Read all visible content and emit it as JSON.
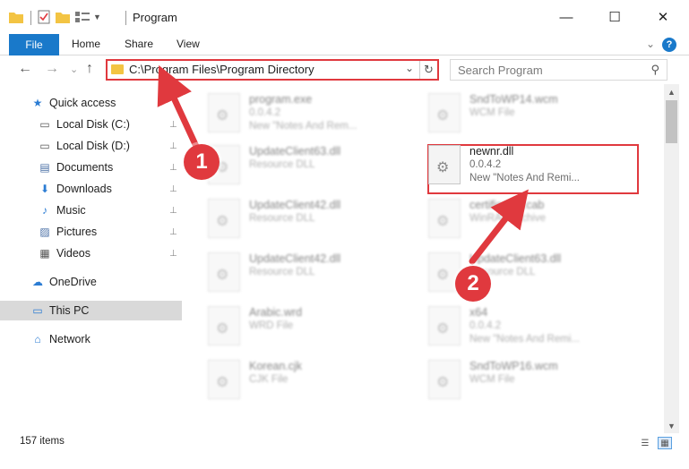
{
  "window": {
    "title": "Program",
    "minimize": "—",
    "maximize": "☐",
    "close": "✕"
  },
  "ribbon": {
    "tabs": [
      "File",
      "Home",
      "Share",
      "View"
    ],
    "expand": "⌄",
    "help": "?"
  },
  "nav": {
    "back": "←",
    "forward": "→",
    "recent": "⌄",
    "up": "↑",
    "address": "C:\\Program Files\\Program Directory",
    "refresh": "↻",
    "search_placeholder": "Search Program",
    "search_icon": "⚲"
  },
  "sidebar": {
    "items": [
      {
        "label": "Quick access",
        "icon": "star-icon",
        "glyph": "★",
        "color": "#2b7cd3",
        "pinned": false
      },
      {
        "label": "Local Disk (C:)",
        "icon": "drive-icon",
        "glyph": "▭",
        "color": "#555555",
        "pinned": true
      },
      {
        "label": "Local Disk (D:)",
        "icon": "drive-icon",
        "glyph": "▭",
        "color": "#555555",
        "pinned": true
      },
      {
        "label": "Documents",
        "icon": "documents-icon",
        "glyph": "▤",
        "color": "#4a6fa5",
        "pinned": true
      },
      {
        "label": "Downloads",
        "icon": "download-icon",
        "glyph": "⬇",
        "color": "#2b7cd3",
        "pinned": true
      },
      {
        "label": "Music",
        "icon": "music-icon",
        "glyph": "♪",
        "color": "#2b7cd3",
        "pinned": true
      },
      {
        "label": "Pictures",
        "icon": "pictures-icon",
        "glyph": "▨",
        "color": "#4a6fa5",
        "pinned": true
      },
      {
        "label": "Videos",
        "icon": "videos-icon",
        "glyph": "▦",
        "color": "#555555",
        "pinned": true
      },
      {
        "label": "OneDrive",
        "icon": "cloud-icon",
        "glyph": "☁",
        "color": "#2b7cd3",
        "pinned": false
      },
      {
        "label": "This PC",
        "icon": "computer-icon",
        "glyph": "▭",
        "color": "#2b7cd3",
        "pinned": false
      },
      {
        "label": "Network",
        "icon": "network-icon",
        "glyph": "⌂",
        "color": "#2b7cd3",
        "pinned": false
      }
    ],
    "pin_glyph": "📌"
  },
  "files": [
    {
      "name": "program.exe",
      "line2": "0.0.4.2",
      "line3": "New \"Notes And Rem...",
      "blurred": true
    },
    {
      "name": "SndToWP14.wcm",
      "line2": "WCM File",
      "line3": "",
      "blurred": true
    },
    {
      "name": "UpdateClient63.dll",
      "line2": "Resource DLL",
      "line3": "",
      "blurred": true
    },
    {
      "name": "newnr.dll",
      "line2": "0.0.4.2",
      "line3": "New \"Notes And Remi...",
      "blurred": false
    },
    {
      "name": "UpdateClient42.dll",
      "line2": "Resource DLL",
      "line3": "",
      "blurred": true
    },
    {
      "name": "certificates.cab",
      "line2": "WinRAR Archive",
      "line3": "",
      "blurred": true
    },
    {
      "name": "UpdateClient42.dll",
      "line2": "Resource DLL",
      "line3": "",
      "blurred": true
    },
    {
      "name": "UpdateClient63.dll",
      "line2": "Resource DLL",
      "line3": "",
      "blurred": true
    },
    {
      "name": "Arabic.wrd",
      "line2": "WRD File",
      "line3": "",
      "blurred": true
    },
    {
      "name": "x64",
      "line2": "0.0.4.2",
      "line3": "New \"Notes And Remi...",
      "blurred": true
    },
    {
      "name": "Korean.cjk",
      "line2": "CJK File",
      "line3": "",
      "blurred": true
    },
    {
      "name": "SndToWP16.wcm",
      "line2": "WCM File",
      "line3": "",
      "blurred": true
    }
  ],
  "status": {
    "items_count": "157 items"
  },
  "annotations": {
    "marker1": "1",
    "marker2": "2",
    "color": "#e0393e"
  }
}
